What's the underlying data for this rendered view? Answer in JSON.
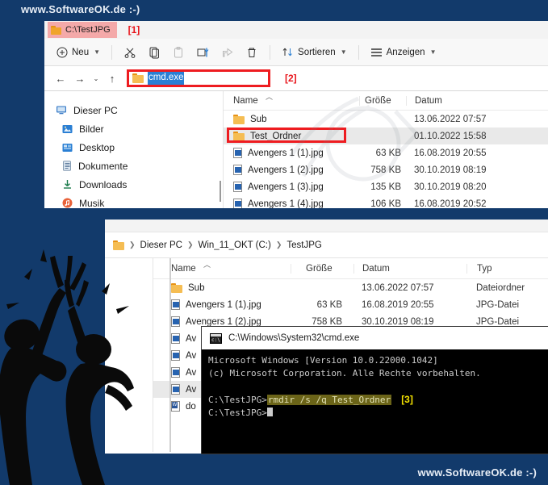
{
  "watermark": {
    "top": "www.SoftwareOK.de  :-)",
    "bottom": "www.SoftwareOK.de  :-)"
  },
  "markers": {
    "one": "[1]",
    "two": "[2]",
    "three": "[3]"
  },
  "window1": {
    "tab_label": "C:\\TestJPG",
    "toolbar": {
      "new_label": "Neu",
      "cut_label": "",
      "copy_label": "",
      "paste_label": "",
      "rename_label": "",
      "share_label": "",
      "delete_label": "",
      "sort_label": "Sortieren",
      "view_label": "Anzeigen"
    },
    "address": {
      "value": "cmd.exe"
    },
    "nav_items": [
      {
        "label": "Dieser PC",
        "icon": "monitor-icon"
      },
      {
        "label": "Bilder",
        "icon": "pictures-icon"
      },
      {
        "label": "Desktop",
        "icon": "desktop-icon"
      },
      {
        "label": "Dokumente",
        "icon": "documents-icon"
      },
      {
        "label": "Downloads",
        "icon": "downloads-icon"
      },
      {
        "label": "Musik",
        "icon": "music-icon"
      }
    ],
    "columns": {
      "name": "Name",
      "size": "Größe",
      "date": "Datum"
    },
    "rows": [
      {
        "name": "Sub",
        "size": "",
        "date": "13.06.2022 07:57",
        "icon": "folder",
        "selected": false
      },
      {
        "name": "Test_Ordner",
        "size": "",
        "date": "01.10.2022 15:58",
        "icon": "folder",
        "selected": true
      },
      {
        "name": "Avengers 1 (1).jpg",
        "size": "63 KB",
        "date": "16.08.2019 20:55",
        "icon": "jpg",
        "selected": false
      },
      {
        "name": "Avengers 1 (2).jpg",
        "size": "758 KB",
        "date": "30.10.2019 08:19",
        "icon": "jpg",
        "selected": false
      },
      {
        "name": "Avengers 1 (3).jpg",
        "size": "135 KB",
        "date": "30.10.2019 08:20",
        "icon": "jpg",
        "selected": false
      },
      {
        "name": "Avengers 1 (4).jpg",
        "size": "106 KB",
        "date": "16.08.2019 20:52",
        "icon": "jpg",
        "selected": false
      }
    ]
  },
  "window2": {
    "breadcrumb": [
      "Dieser PC",
      "Win_11_OKT (C:)",
      "TestJPG"
    ],
    "columns": {
      "name": "Name",
      "size": "Größe",
      "date": "Datum",
      "type": "Typ"
    },
    "rows": [
      {
        "name": "Sub",
        "size": "",
        "date": "13.06.2022 07:57",
        "type": "Dateiordner",
        "icon": "folder",
        "selected": false
      },
      {
        "name": "Avengers 1 (1).jpg",
        "size": "63 KB",
        "date": "16.08.2019 20:55",
        "type": "JPG-Datei",
        "icon": "jpg",
        "selected": false
      },
      {
        "name": "Avengers 1 (2).jpg",
        "size": "758 KB",
        "date": "30.10.2019 08:19",
        "type": "JPG-Datei",
        "icon": "jpg",
        "selected": false
      },
      {
        "name": "Av",
        "size": "",
        "date": "",
        "type": "",
        "icon": "jpg",
        "selected": false
      },
      {
        "name": "Av",
        "size": "",
        "date": "",
        "type": "",
        "icon": "jpg",
        "selected": false
      },
      {
        "name": "Av",
        "size": "",
        "date": "",
        "type": "",
        "icon": "jpg",
        "selected": false
      },
      {
        "name": "Av",
        "size": "",
        "date": "",
        "type": "",
        "icon": "jpg",
        "selected": true
      },
      {
        "name": "do",
        "size": "",
        "date": "",
        "type": "",
        "icon": "doc",
        "selected": false
      }
    ]
  },
  "cmd": {
    "title": "C:\\Windows\\System32\\cmd.exe",
    "line1": "Microsoft Windows [Version 10.0.22000.1042]",
    "line2": "(c) Microsoft Corporation. Alle Rechte vorbehalten.",
    "prompt1": "C:\\TestJPG>",
    "command": "rmdir /s /q Test_Ordner",
    "prompt2": "C:\\TestJPG>"
  },
  "colors": {
    "background": "#123a6b",
    "marker_red": "#e8141b",
    "marker_yellow": "#f5e300",
    "highlight_box": "#ee1c20",
    "tab_highlight": "#f4a9a9",
    "selection_blue": "#2a7fd4",
    "cmd_selection": "#6b6418"
  }
}
